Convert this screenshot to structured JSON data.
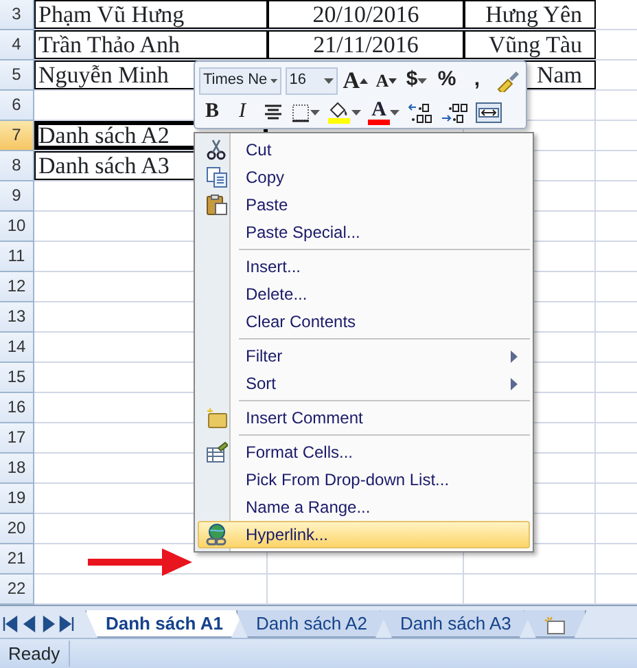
{
  "sheet": {
    "rows": [
      {
        "number": "3",
        "selected": false,
        "cells": [
          {
            "text": "Phạm Vũ Hưng",
            "bordered": true,
            "active": false
          },
          {
            "text": "20/10/2016",
            "bordered": true,
            "active": false
          },
          {
            "text": "Hưng Yên",
            "bordered": true,
            "active": false
          }
        ]
      },
      {
        "number": "4",
        "selected": false,
        "cells": [
          {
            "text": "Trần Thảo Anh",
            "bordered": true,
            "active": false
          },
          {
            "text": "21/11/2016",
            "bordered": true,
            "active": false
          },
          {
            "text": "Vũng Tàu",
            "bordered": true,
            "active": false
          }
        ]
      },
      {
        "number": "5",
        "selected": false,
        "cells": [
          {
            "text": "Nguyễn Minh",
            "bordered": true,
            "active": false
          },
          null,
          {
            "text": "Nam",
            "bordered": true,
            "active": false
          }
        ]
      },
      {
        "number": "6",
        "selected": false
      },
      {
        "number": "7",
        "selected": true,
        "cells": [
          {
            "text": "Danh sách A2",
            "bordered": true,
            "active": true
          }
        ]
      },
      {
        "number": "8",
        "selected": false,
        "cells": [
          {
            "text": "Danh sách A3",
            "bordered": true,
            "active": false
          }
        ]
      },
      {
        "number": "9",
        "selected": false
      },
      {
        "number": "10",
        "selected": false
      },
      {
        "number": "11",
        "selected": false
      },
      {
        "number": "12",
        "selected": false
      },
      {
        "number": "13",
        "selected": false
      },
      {
        "number": "14",
        "selected": false
      },
      {
        "number": "15",
        "selected": false
      },
      {
        "number": "16",
        "selected": false
      },
      {
        "number": "17",
        "selected": false
      },
      {
        "number": "18",
        "selected": false
      },
      {
        "number": "19",
        "selected": false
      },
      {
        "number": "20",
        "selected": false
      },
      {
        "number": "21",
        "selected": false
      },
      {
        "number": "22",
        "selected": false
      }
    ]
  },
  "mini_toolbar": {
    "font_name": "Times Ne",
    "font_size": "16",
    "top_buttons": [
      {
        "kind": "grow",
        "text": "A"
      },
      {
        "kind": "shrink",
        "text": "A"
      },
      {
        "kind": "text",
        "text": "$",
        "dropdown": true
      },
      {
        "kind": "text",
        "text": "%",
        "dropdown": false
      },
      {
        "kind": "text",
        "text": ",",
        "dropdown": false
      },
      {
        "kind": "painter",
        "dropdown": false
      }
    ],
    "bottom_buttons": [
      {
        "kind": "bold",
        "text": "B",
        "dropdown": false
      },
      {
        "kind": "italic",
        "text": "I",
        "dropdown": false
      },
      {
        "kind": "align",
        "dropdown": false
      },
      {
        "kind": "borders",
        "dropdown": true
      },
      {
        "kind": "fill",
        "color": "#ffff00",
        "dropdown": true
      },
      {
        "kind": "fontcolor",
        "text": "A",
        "color": "#ff0000",
        "dropdown": true
      },
      {
        "kind": "incdec",
        "dropdown": false
      },
      {
        "kind": "decdec",
        "dropdown": false
      },
      {
        "kind": "merge",
        "dropdown": false
      }
    ]
  },
  "context_menu": {
    "groups": [
      [
        {
          "label": "Cut",
          "kind": "cut",
          "selected": false
        },
        {
          "label": "Copy",
          "kind": "copy",
          "selected": false
        },
        {
          "label": "Paste",
          "kind": "paste",
          "selected": false
        },
        {
          "label": "Paste Special...",
          "kind": "plain",
          "selected": false
        }
      ],
      [
        {
          "label": "Insert...",
          "kind": "plain",
          "selected": false
        },
        {
          "label": "Delete...",
          "kind": "plain",
          "selected": false
        },
        {
          "label": "Clear Contents",
          "kind": "plain",
          "selected": false
        }
      ],
      [
        {
          "label": "Filter",
          "kind": "submenu",
          "selected": false
        },
        {
          "label": "Sort",
          "kind": "submenu",
          "selected": false
        }
      ],
      [
        {
          "label": "Insert Comment",
          "kind": "comment",
          "selected": false
        }
      ],
      [
        {
          "label": "Format Cells...",
          "kind": "format",
          "selected": false
        },
        {
          "label": "Pick From Drop-down List...",
          "kind": "plain",
          "selected": false
        },
        {
          "label": "Name a Range...",
          "kind": "plain",
          "selected": false
        },
        {
          "label": "Hyperlink...",
          "kind": "hyperlink",
          "selected": true
        }
      ]
    ]
  },
  "sheet_tabs": [
    {
      "label": "Danh sách A1",
      "selected": true
    },
    {
      "label": "Danh sách A2",
      "selected": false
    },
    {
      "label": "Danh sách A3",
      "selected": false
    }
  ],
  "status_bar": {
    "text": "Ready"
  }
}
